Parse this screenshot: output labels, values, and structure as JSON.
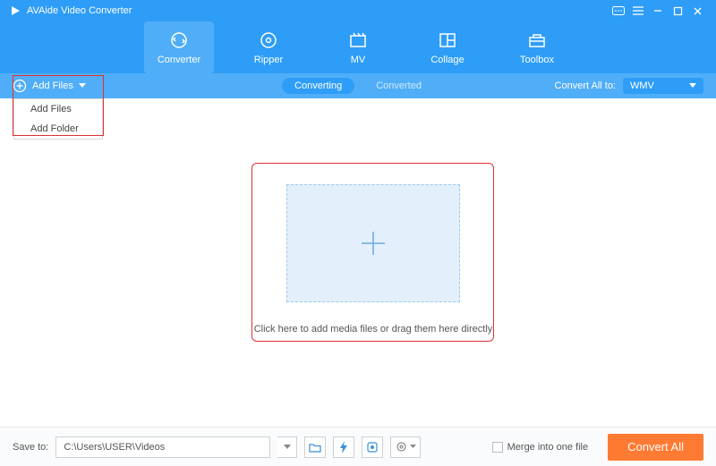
{
  "titlebar": {
    "app_name": "AVAide Video Converter"
  },
  "tabs": {
    "converter": "Converter",
    "ripper": "Ripper",
    "mv": "MV",
    "collage": "Collage",
    "toolbox": "Toolbox"
  },
  "subbar": {
    "add_files": "Add Files",
    "converting": "Converting",
    "converted": "Converted",
    "convert_all_to": "Convert All to:",
    "format": "WMV"
  },
  "add_menu": {
    "add_files": "Add Files",
    "add_folder": "Add Folder"
  },
  "dropzone": {
    "text": "Click here to add media files or drag them here directly"
  },
  "bottom": {
    "save_to": "Save to:",
    "path": "C:\\Users\\USER\\Videos",
    "merge": "Merge into one file",
    "convert_all": "Convert All"
  }
}
